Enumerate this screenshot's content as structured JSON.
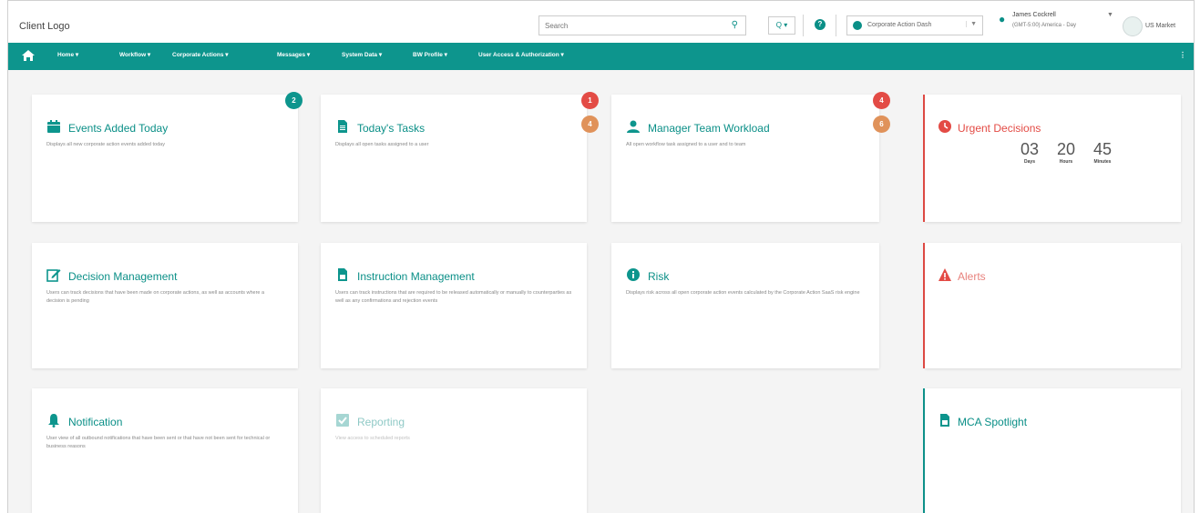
{
  "header": {
    "logo": "Client Logo",
    "search_placeholder": "Search",
    "zoom_label": "Q ▾",
    "help_label": "?",
    "dashboard_select": "Corporate Action Dash",
    "user_name": "James Cockrell",
    "user_timezone": "(GMT-5:00) America - Day",
    "market_label": "US Market"
  },
  "nav": {
    "items": [
      "Home ▾",
      "Workflow ▾",
      "Corporate Actions ▾",
      "Messages ▾",
      "System Data ▾",
      "BW Profile ▾",
      "User Access & Authorization ▾"
    ],
    "more": "⋮"
  },
  "cards": {
    "events": {
      "title": "Events Added Today",
      "desc": "Displays all new corporate action events added today",
      "badge": "2"
    },
    "tasks": {
      "title": "Today's Tasks",
      "desc": "Displays all open tasks assigned to a user",
      "badge_red": "1",
      "badge_orange": "4"
    },
    "manager": {
      "title": "Manager Team Workload",
      "desc": "All open workflow task assigned to a user and to team",
      "badge_red": "4",
      "badge_orange": "6"
    },
    "urgent": {
      "title": "Urgent Decisions",
      "days": "03",
      "hours": "20",
      "minutes": "45",
      "days_label": "Days",
      "hours_label": "Hours",
      "minutes_label": "Minutes"
    },
    "decision": {
      "title": "Decision Management",
      "desc": "Users can track decisions that have been made on corporate actions, as well as accounts where a decision is pending"
    },
    "instruction": {
      "title": "Instruction Management",
      "desc": "Users can track instructions that are required to be released automatically or manually to counterparties as well as any confirmations and rejection events"
    },
    "risk": {
      "title": "Risk",
      "desc": "Displays risk across all open corporate action events calculated by the Corporate Action SaaS risk engine"
    },
    "alerts": {
      "title": "Alerts"
    },
    "notification": {
      "title": "Notification",
      "desc": "User view of all outbound notifications that have been sent or that have not been sent for technical or business reasons"
    },
    "reporting": {
      "title": "Reporting",
      "desc": "View access to scheduled reports"
    },
    "mca": {
      "title": "MCA Spotlight"
    }
  },
  "colors": {
    "brand": "#0d958d",
    "danger": "#e34b45",
    "warning": "#e0925a"
  }
}
